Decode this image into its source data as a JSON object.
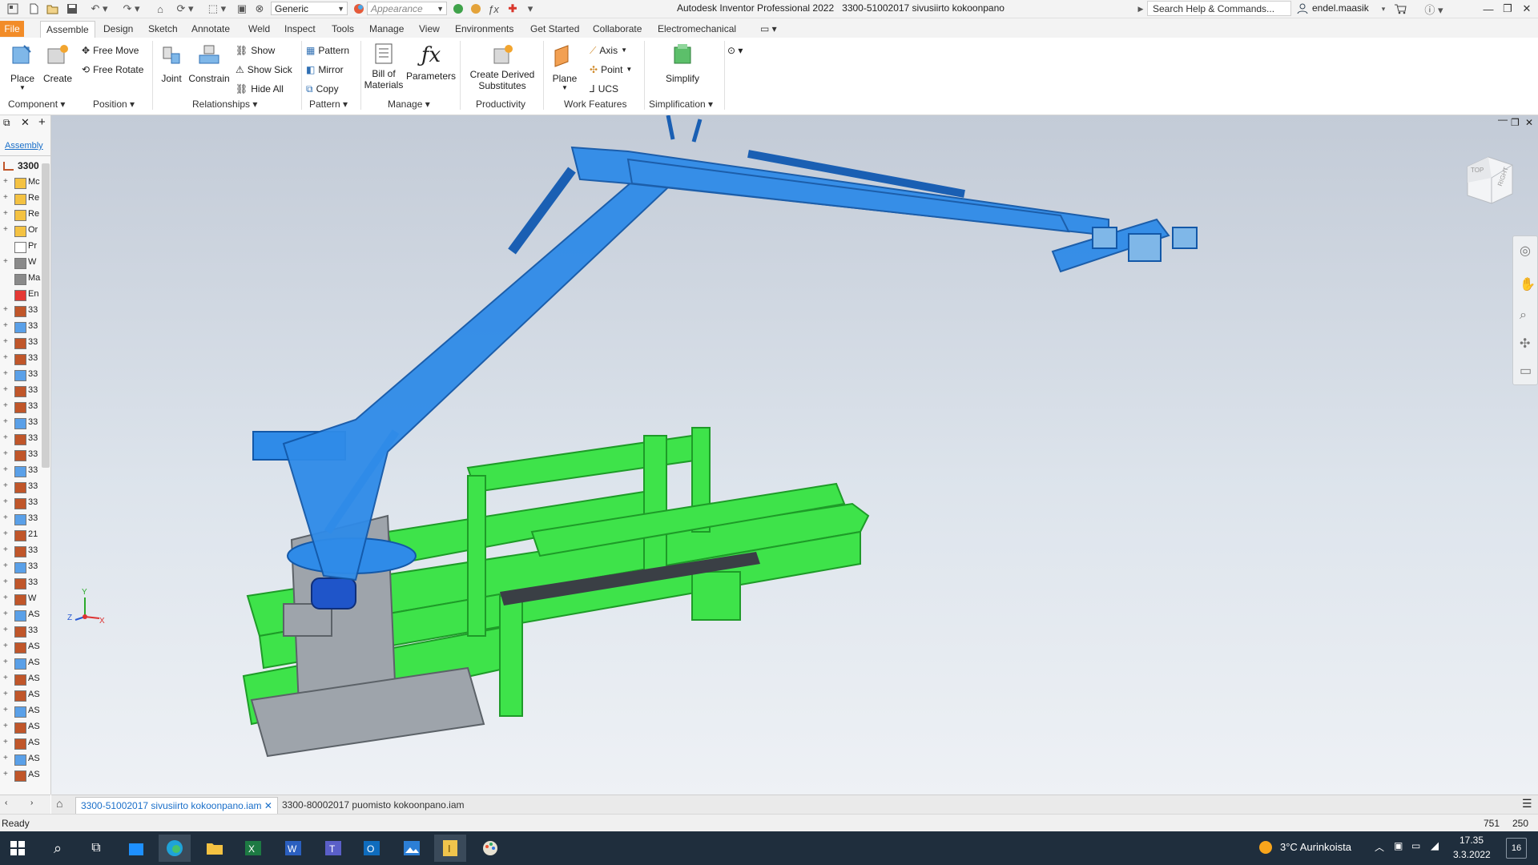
{
  "titlebar": {
    "style_value": "Generic",
    "appearance_placeholder": "Appearance",
    "app_title": "Autodesk Inventor Professional 2022",
    "document_title": "3300-51002017 sivusiirto kokoonpano",
    "search_placeholder": "Search Help & Commands...",
    "user": "endel.maasik"
  },
  "tabs": [
    "File",
    "Assemble",
    "Design",
    "Sketch",
    "Annotate",
    "Weld",
    "Inspect",
    "Tools",
    "Manage",
    "View",
    "Environments",
    "Get Started",
    "Collaborate",
    "Electromechanical"
  ],
  "active_tab": "Assemble",
  "ribbon": {
    "place": "Place",
    "create": "Create",
    "free_move": "Free Move",
    "free_rotate": "Free Rotate",
    "joint": "Joint",
    "constrain": "Constrain",
    "show": "Show",
    "show_sick": "Show Sick",
    "hide_all": "Hide All",
    "pattern": "Pattern",
    "mirror": "Mirror",
    "copy": "Copy",
    "bill_of": "Bill of",
    "materials": "Materials",
    "parameters": "Parameters",
    "create_derived": "Create Derived",
    "substitutes": "Substitutes",
    "plane": "Plane",
    "axis": "Axis",
    "point": "Point",
    "ucs": "UCS",
    "simplify": "Simplify",
    "panels": {
      "component": "Component",
      "position": "Position",
      "relationships": "Relationships",
      "pattern": "Pattern",
      "manage": "Manage",
      "productivity": "Productivity",
      "work_features": "Work Features",
      "simplification": "Simplification"
    }
  },
  "browser": {
    "tab_label": "Assembly",
    "root": "3300",
    "rows": [
      "Mc",
      "Re",
      "Re",
      "Or",
      "Pr",
      "W",
      "Ma",
      "En",
      "33",
      "33",
      "33",
      "33",
      "33",
      "33",
      "33",
      "33",
      "33",
      "33",
      "33",
      "33",
      "33",
      "33",
      "21",
      "33",
      "33",
      "33",
      "W",
      "AS",
      "33",
      "AS",
      "AS",
      "AS",
      "AS",
      "AS",
      "AS",
      "AS",
      "AS",
      "AS"
    ]
  },
  "viewcube": {
    "top": "TOP",
    "right": "RIGHT"
  },
  "triad": {
    "x": "X",
    "y": "Y",
    "z": "Z"
  },
  "doctabs": [
    "3300-51002017 sivusiirto kokoonpano.iam",
    "3300-80002017 puomisto kokoonpano.iam"
  ],
  "status": {
    "text": "Ready",
    "num1": "751",
    "num2": "250"
  },
  "taskbar": {
    "weather": "3°C  Aurinkoista",
    "time": "17.35",
    "date": "3.3.2022",
    "notif": "16"
  },
  "colors": {
    "file_tab": "#f28c28",
    "boom_blue": "#2f8be8",
    "frame_green": "#3ee34a",
    "taskbar": "#1f2e3d"
  }
}
